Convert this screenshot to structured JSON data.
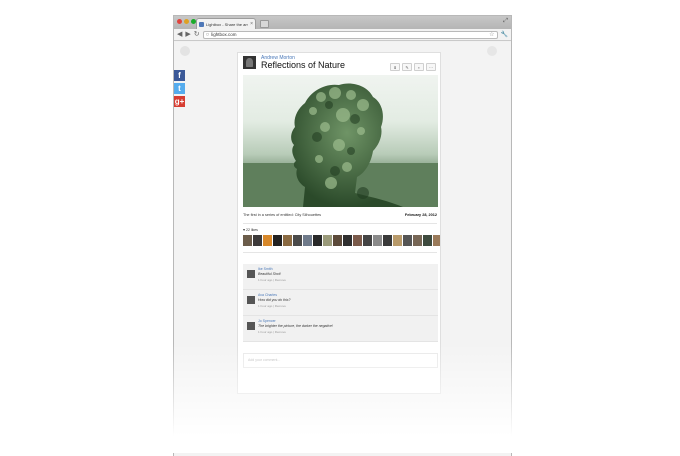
{
  "browser": {
    "tab_title": "Lightbox - Share the amazing",
    "url": "lightbox.com",
    "colors": {
      "close": "#e0443e",
      "minimize": "#dea123",
      "zoom": "#1aab29"
    },
    "icons": [
      "back-icon",
      "forward-icon",
      "reload-icon",
      "star-icon",
      "wrench-icon"
    ]
  },
  "share": {
    "facebook": {
      "label": "f",
      "color": "#3b5998"
    },
    "twitter": {
      "label": "t",
      "color": "#55acee"
    },
    "googleplus": {
      "label": "g+",
      "color": "#d73d32"
    }
  },
  "post": {
    "author": "Andrew Morton",
    "title": "Reflections of Nature",
    "actions": [
      "download-icon",
      "edit-icon",
      "delete-icon",
      "more-icon"
    ],
    "caption": "The first in a series of entitled: City Silhouettes",
    "date": "February 28, 2012",
    "likes_label": "♥ 22 likes",
    "like_thumb_colors": [
      "#6b5c4a",
      "#3d3a3a",
      "#d7882a",
      "#222",
      "#8a6a42",
      "#4a4a4a",
      "#6f7a8a",
      "#292929",
      "#9a9a7a",
      "#5c4a3a",
      "#2f2f2f",
      "#7a5a4a",
      "#444",
      "#8a8a8a",
      "#3a3a3a",
      "#b89a6a",
      "#555",
      "#776655",
      "#3e4a3e",
      "#9a7a5a",
      "#2a2a2a",
      "#c8b090"
    ]
  },
  "comments": [
    {
      "name": "Ike Smith",
      "text": "Beautiful Shot!",
      "meta": "1 hour ago  |  Remove"
    },
    {
      "name": "Ava Charles",
      "text": "How did you do this?",
      "meta": "1 hour ago  |  Remove"
    },
    {
      "name": "Jo Spencer",
      "text": "The brighter the picture, the darker the negative!",
      "meta": "1 hour ago  |  Remove"
    }
  ],
  "comment_input": {
    "placeholder": "Add your comment..."
  }
}
